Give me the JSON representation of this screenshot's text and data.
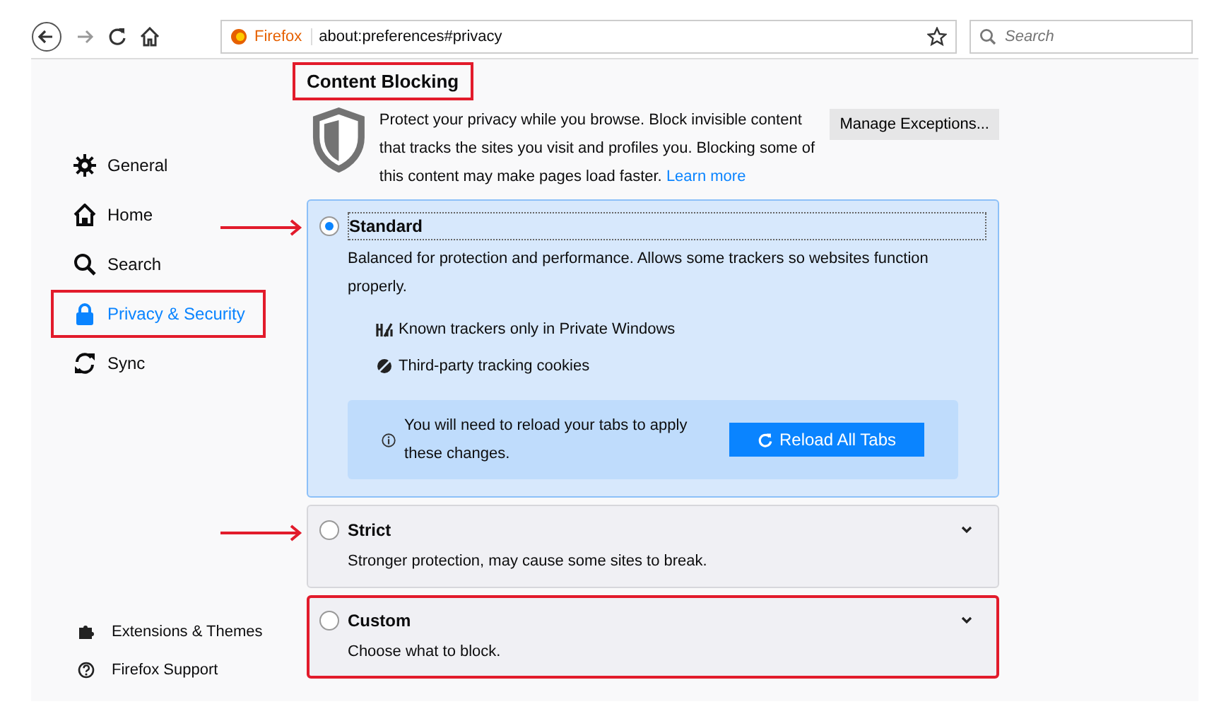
{
  "toolbar": {
    "identity": "Firefox",
    "url": "about:preferences#privacy",
    "search": {
      "placeholder": "Search"
    }
  },
  "sidebar": {
    "items": [
      {
        "kind": "gear",
        "label": "General",
        "selected": false,
        "highlighted": false
      },
      {
        "kind": "home",
        "label": "Home",
        "selected": false,
        "highlighted": false
      },
      {
        "kind": "search",
        "label": "Search",
        "selected": false,
        "highlighted": false
      },
      {
        "kind": "lock",
        "label": "Privacy & Security",
        "selected": true,
        "highlighted": true
      },
      {
        "kind": "sync",
        "label": "Sync",
        "selected": false,
        "highlighted": false
      }
    ],
    "footer": [
      {
        "kind": "extensions",
        "label": "Extensions & Themes"
      },
      {
        "kind": "support",
        "label": "Firefox Support"
      }
    ]
  },
  "section": {
    "heading": "Content Blocking",
    "highlighted": true,
    "description": "Protect your privacy while you browse. Block invisible content that tracks the sites you visit and profiles you. Blocking some of this content may make pages load faster.",
    "learn_more": "Learn more",
    "manage_button": "Manage Exceptions..."
  },
  "options": [
    {
      "label": "Standard",
      "description": "Balanced for protection and performance. Allows some trackers so websites function properly.",
      "selected": true,
      "expanded": true,
      "highlighted": false,
      "arrow": true,
      "features": [
        {
          "kind": "trackers",
          "label": "Known trackers only in Private Windows"
        },
        {
          "kind": "cookies",
          "label": "Third-party tracking cookies"
        }
      ],
      "notice": {
        "text": "You will need to reload your tabs to apply these changes.",
        "button": "Reload All Tabs"
      }
    },
    {
      "label": "Strict",
      "description": "Stronger protection, may cause some sites to break.",
      "selected": false,
      "expanded": false,
      "highlighted": false,
      "arrow": true
    },
    {
      "label": "Custom",
      "description": "Choose what to block.",
      "selected": false,
      "expanded": false,
      "highlighted": true,
      "arrow": false
    }
  ]
}
